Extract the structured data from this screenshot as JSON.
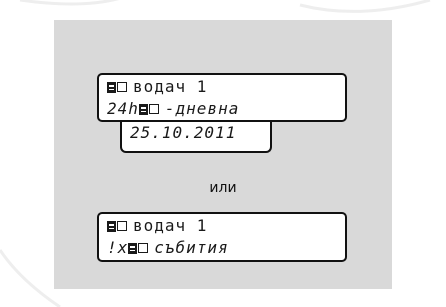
{
  "display1": {
    "line1_text": "водач 1",
    "line2_prefix": "24h",
    "line2_text": "-дневна",
    "date": "25.10.2011"
  },
  "separator": {
    "label": "или"
  },
  "display2": {
    "line1_text": "водач 1",
    "line2_prefix": "!x",
    "line2_text": "събития"
  },
  "icons": [
    "card-icon",
    "slot-icon"
  ]
}
